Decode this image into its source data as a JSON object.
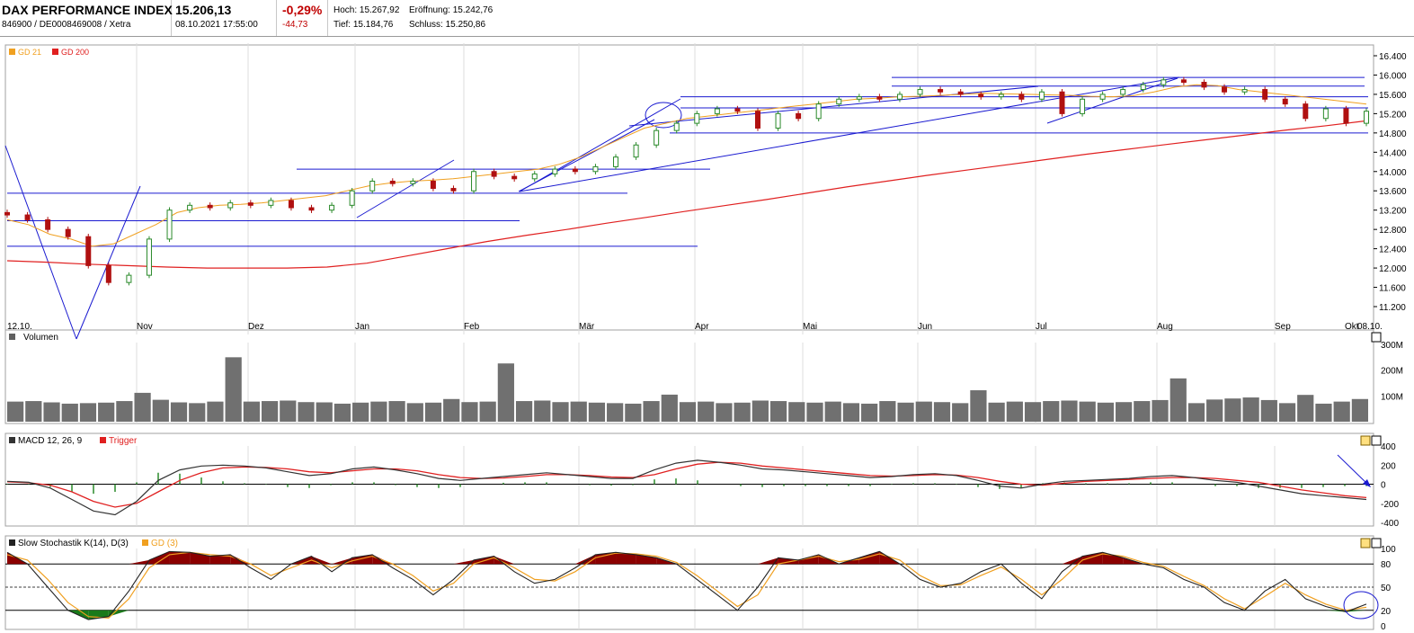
{
  "header": {
    "title": "DAX PERFORMANCE INDEX",
    "ident": "846900 / DE0008469008 / Xetra",
    "price": "15.206,13",
    "datetime": "08.10.2021 17:55:00",
    "change_pct": "-0,29%",
    "change_abs": "-44,73",
    "high": "Hoch: 15.267,92",
    "open": "Eröffnung: 15.242,76",
    "low": "Tief: 15.184,76",
    "close": "Schluss: 15.250,86"
  },
  "colors": {
    "gd21": "#f0a020",
    "gd200": "#e02020",
    "up": "#2a8a2a",
    "down": "#b01010",
    "trendline": "#1a1ad0",
    "macd": "#333333",
    "trigger": "#e02020",
    "stoch_k": "#222222",
    "stoch_d": "#f0a020",
    "stoch_fill_high": "#8b0000",
    "stoch_fill_low": "#1a7a1a",
    "volume": "#707070"
  },
  "icons": [
    "close-icon",
    "settings-icon"
  ],
  "chart_data": [
    {
      "type": "line",
      "legend": [
        "GD 21",
        "GD 200"
      ],
      "x_ticks": [
        "12.10.",
        "Nov",
        "Dez",
        "Jan",
        "Feb",
        "Mär",
        "Apr",
        "Mai",
        "Jun",
        "Jul",
        "Aug",
        "Sep",
        "Okt",
        "08.10."
      ],
      "y_ticks": [
        "16.400",
        "16.000",
        "15.600",
        "15.200",
        "14.800",
        "14.400",
        "14.000",
        "13.600",
        "13.200",
        "12.800",
        "12.400",
        "12.000",
        "11.600",
        "11.200"
      ],
      "ylim": [
        11200,
        16400
      ],
      "close_series": [
        13100,
        13000,
        12800,
        12650,
        12050,
        11700,
        11850,
        12600,
        13200,
        13300,
        13250,
        13350,
        13300,
        13400,
        13250,
        13200,
        13300,
        13600,
        13800,
        13750,
        13800,
        13650,
        13600,
        14000,
        13900,
        13850,
        13950,
        14050,
        14000,
        14100,
        14300,
        14550,
        14850,
        15000,
        15200,
        15300,
        15250,
        14900,
        15200,
        15100,
        15400,
        15500,
        15550,
        15500,
        15600,
        15700,
        15650,
        15600,
        15550,
        15600,
        15500,
        15650,
        15200,
        15500,
        15600,
        15700,
        15800,
        15900,
        15850,
        15750,
        15650,
        15700,
        15500,
        15400,
        15100,
        15300,
        15000,
        15250
      ],
      "gd21_series": [
        13000,
        12900,
        12700,
        12600,
        12450,
        12500,
        12700,
        12900,
        13150,
        13250,
        13300,
        13320,
        13350,
        13400,
        13450,
        13500,
        13600,
        13700,
        13760,
        13800,
        13820,
        13850,
        13900,
        13950,
        14000,
        14050,
        14150,
        14300,
        14500,
        14700,
        14900,
        15000,
        15100,
        15150,
        15200,
        15250,
        15300,
        15350,
        15400,
        15450,
        15500,
        15520,
        15550,
        15560,
        15580,
        15600,
        15620,
        15610,
        15600,
        15590,
        15580,
        15560,
        15550,
        15570,
        15650,
        15750,
        15800,
        15780,
        15700,
        15650,
        15600,
        15550,
        15500,
        15450,
        15400
      ],
      "gd200_series": [
        12150,
        12120,
        12080,
        12050,
        12020,
        12000,
        12000,
        12000,
        12020,
        12100,
        12250,
        12400,
        12550,
        12680,
        12800,
        12930,
        13050,
        13180,
        13300,
        13420,
        13550,
        13680,
        13800,
        13920,
        14030,
        14140,
        14250,
        14360,
        14460,
        14560,
        14660,
        14760,
        14860,
        14950,
        15050
      ],
      "horizontal_levels": [
        15950,
        15770,
        15550,
        15320,
        14800,
        14050,
        13550,
        12980,
        12450
      ]
    },
    {
      "type": "bar",
      "title": "Volumen",
      "y_ticks": [
        "300M",
        "200M",
        "100M"
      ],
      "ylim": [
        0,
        300
      ],
      "values": [
        78,
        80,
        75,
        70,
        72,
        74,
        80,
        112,
        85,
        75,
        72,
        78,
        250,
        78,
        80,
        82,
        76,
        75,
        70,
        74,
        78,
        80,
        72,
        74,
        88,
        76,
        78,
        226,
        80,
        82,
        76,
        78,
        74,
        72,
        70,
        80,
        105,
        76,
        78,
        72,
        74,
        82,
        80,
        76,
        74,
        78,
        72,
        70,
        80,
        74,
        78,
        76,
        72,
        122,
        74,
        78,
        76,
        80,
        82,
        78,
        74,
        76,
        80,
        84,
        168,
        72,
        86,
        90,
        94,
        84,
        72,
        104,
        70,
        78,
        88
      ]
    },
    {
      "type": "line",
      "title": "MACD 12, 26, 9",
      "legend": [
        "MACD 12, 26, 9",
        "Trigger"
      ],
      "y_ticks": [
        "400",
        "200",
        "0",
        "-200",
        "-400"
      ],
      "ylim": [
        -400,
        400
      ],
      "macd": [
        30,
        20,
        -40,
        -160,
        -280,
        -320,
        -180,
        40,
        150,
        190,
        200,
        190,
        170,
        130,
        90,
        110,
        160,
        180,
        150,
        110,
        60,
        40,
        60,
        80,
        100,
        120,
        100,
        80,
        60,
        60,
        150,
        220,
        250,
        230,
        200,
        160,
        150,
        130,
        110,
        90,
        70,
        80,
        100,
        110,
        90,
        40,
        -20,
        -40,
        0,
        30,
        40,
        50,
        60,
        80,
        90,
        70,
        40,
        20,
        -20,
        -60,
        -100,
        -120,
        -140,
        -160
      ],
      "trigger": [
        25,
        15,
        -10,
        -80,
        -180,
        -240,
        -200,
        -80,
        40,
        120,
        170,
        180,
        175,
        160,
        130,
        120,
        140,
        160,
        160,
        140,
        100,
        70,
        60,
        65,
        80,
        100,
        100,
        90,
        75,
        70,
        100,
        160,
        210,
        230,
        220,
        190,
        170,
        150,
        130,
        110,
        90,
        85,
        90,
        100,
        95,
        70,
        30,
        0,
        -10,
        10,
        30,
        40,
        50,
        60,
        70,
        70,
        60,
        40,
        20,
        -20,
        -60,
        -90,
        -120,
        -140
      ]
    },
    {
      "type": "line",
      "title": "Slow Stochastik K(14), D(3)",
      "legend": [
        "Slow Stochastik K(14), D(3)",
        "GD (3)"
      ],
      "y_ticks": [
        "100",
        "80",
        "50",
        "20",
        "0"
      ],
      "ylim": [
        0,
        100
      ],
      "reference_levels": [
        80,
        50,
        20
      ],
      "k": [
        95,
        80,
        50,
        20,
        8,
        12,
        45,
        85,
        96,
        95,
        90,
        92,
        75,
        60,
        80,
        90,
        70,
        88,
        92,
        75,
        60,
        40,
        60,
        85,
        90,
        70,
        55,
        60,
        75,
        92,
        95,
        92,
        88,
        80,
        60,
        40,
        20,
        50,
        88,
        85,
        92,
        80,
        88,
        96,
        80,
        60,
        50,
        55,
        70,
        80,
        55,
        35,
        70,
        90,
        95,
        88,
        80,
        75,
        60,
        50,
        30,
        20,
        45,
        60,
        35,
        25,
        18,
        28
      ],
      "d": [
        92,
        85,
        60,
        30,
        12,
        10,
        35,
        75,
        92,
        95,
        92,
        90,
        80,
        65,
        75,
        85,
        75,
        84,
        90,
        80,
        65,
        45,
        55,
        80,
        88,
        75,
        60,
        58,
        70,
        88,
        94,
        93,
        90,
        82,
        65,
        45,
        25,
        40,
        80,
        85,
        90,
        83,
        86,
        93,
        85,
        65,
        52,
        53,
        65,
        76,
        60,
        40,
        60,
        85,
        93,
        90,
        82,
        77,
        64,
        52,
        35,
        22,
        38,
        55,
        40,
        28,
        20,
        24
      ]
    }
  ]
}
